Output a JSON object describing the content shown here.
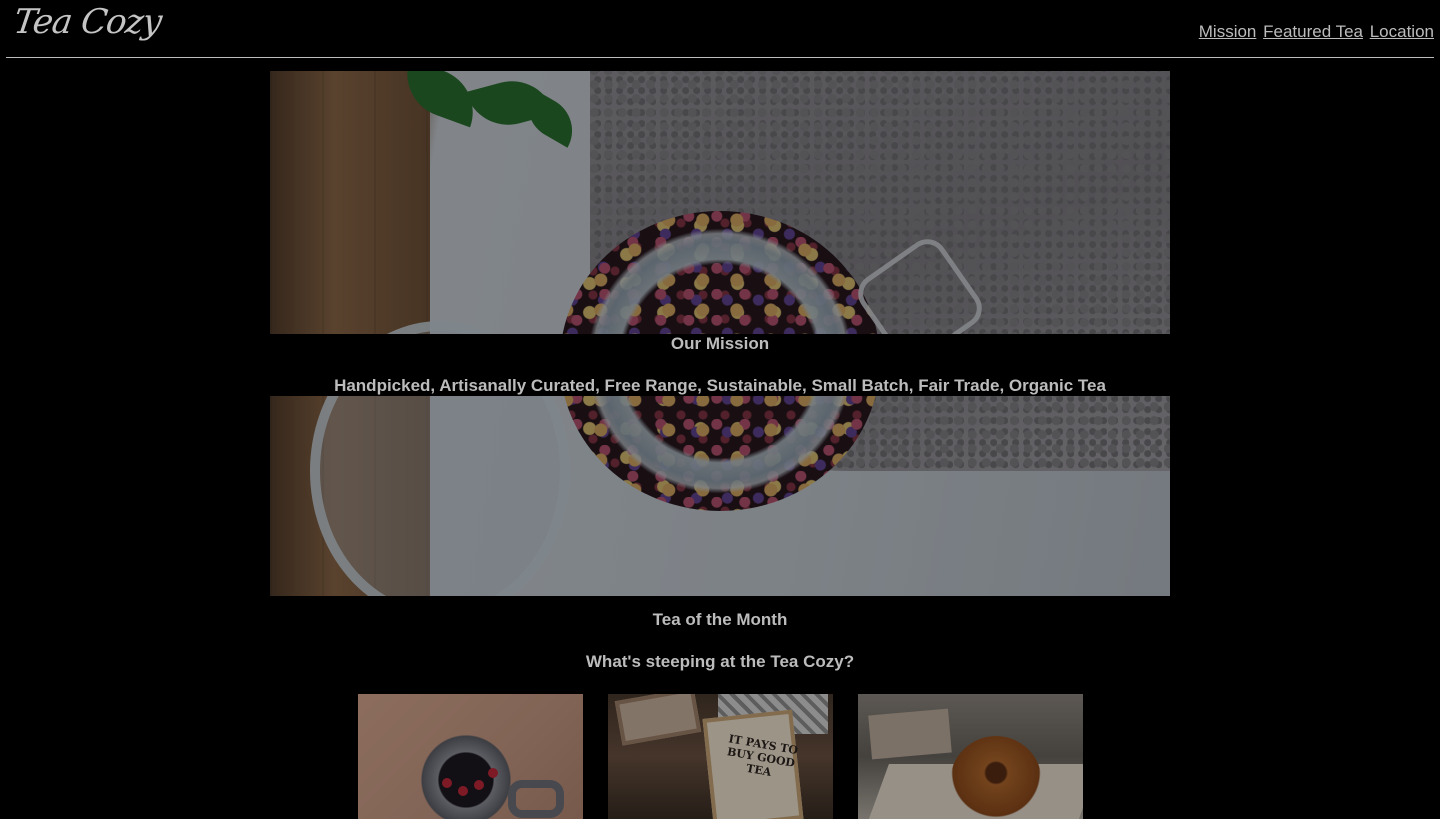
{
  "header": {
    "logo": "Tea Cozy",
    "nav": [
      "Mission",
      "Featured Tea",
      "Location"
    ]
  },
  "mission": {
    "title": "Our Mission",
    "text": "Handpicked, Artisanally Curated, Free Range, Sustainable, Small Batch, Fair Trade, Organic Tea"
  },
  "tea_of_month": {
    "title": "Tea of the Month",
    "subtitle": "What's steeping at the Tea Cozy?"
  },
  "thumbnails": [
    {
      "name": "mug-with-berries"
    },
    {
      "name": "tea-box",
      "sign_text": "IT PAYS TO BUY GOOD TEA"
    },
    {
      "name": "pastry-on-plate"
    }
  ],
  "colors": {
    "background": "#000000",
    "text": "#bcbcbc"
  }
}
